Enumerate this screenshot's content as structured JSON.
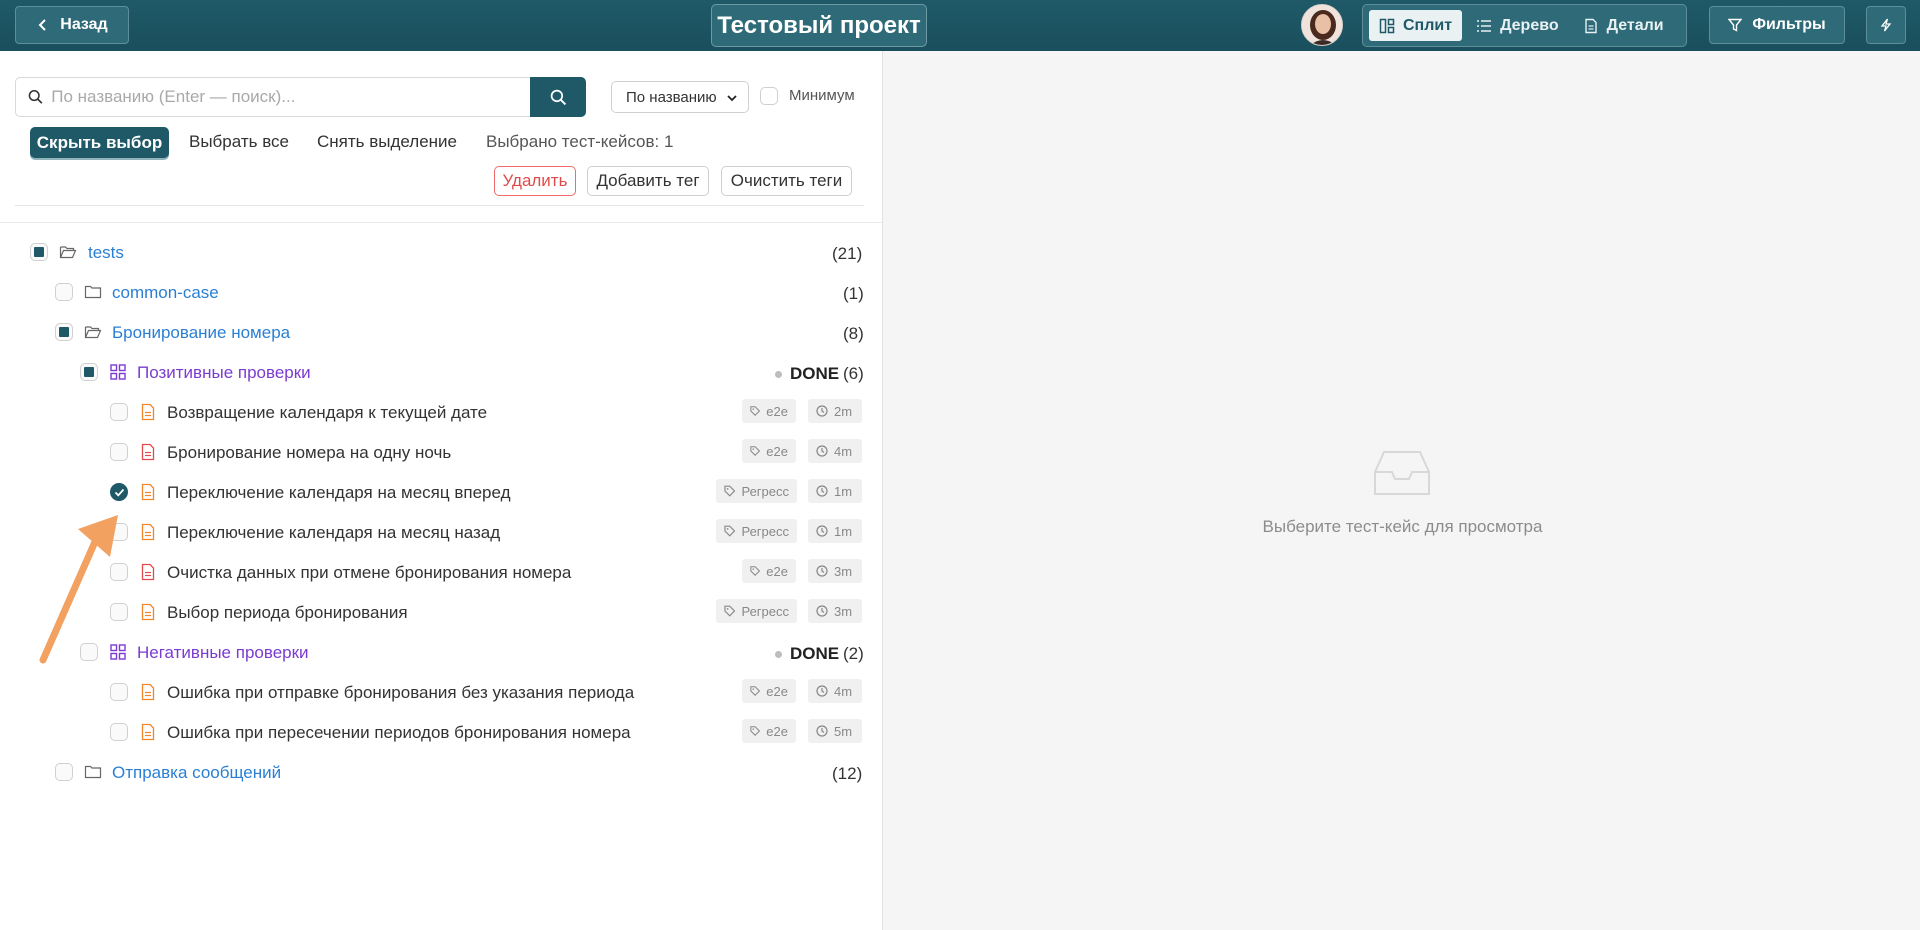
{
  "header": {
    "back_label": "Назад",
    "project_title": "Тестовый проект",
    "views": [
      {
        "label": "Сплит",
        "icon": "split-icon",
        "active": true
      },
      {
        "label": "Дерево",
        "icon": "list-icon",
        "active": false
      },
      {
        "label": "Детали",
        "icon": "document-icon",
        "active": false
      }
    ],
    "filters_label": "Фильтры",
    "accent": "#1f5967"
  },
  "toolbar": {
    "search_placeholder": "По названию (Enter — поиск)...",
    "sort_value": "По названию",
    "minimum_label": "Минимум",
    "hide_selection_label": "Скрыть выбор",
    "select_all_label": "Выбрать все",
    "deselect_label": "Снять выделение",
    "selected_count_label": "Выбрано тест-кейсов: 1",
    "delete_label": "Удалить",
    "add_tag_label": "Добавить тег",
    "clear_tags_label": "Очистить теги"
  },
  "tree": {
    "root": {
      "name": "tests",
      "count": "(21)"
    },
    "common": {
      "name": "common-case",
      "count": "(1)"
    },
    "booking": {
      "name": "Бронирование номера",
      "count": "(8)"
    },
    "positive": {
      "name": "Позитивные проверки",
      "status": "DONE",
      "count": "(6)"
    },
    "positive_cases": [
      {
        "name": "Возвращение календаря к текущей дате",
        "tag": "e2e",
        "time": "2m"
      },
      {
        "name": "Бронирование номера на одну ночь",
        "tag": "e2e",
        "time": "4m"
      },
      {
        "name": "Переключение календаря на месяц вперед",
        "tag": "Регресс",
        "time": "1m"
      },
      {
        "name": "Переключение календаря на месяц назад",
        "tag": "Регресс",
        "time": "1m"
      },
      {
        "name": "Очистка данных при отмене бронирования номера",
        "tag": "e2e",
        "time": "3m"
      },
      {
        "name": "Выбор периода бронирования",
        "tag": "Регресс",
        "time": "3m"
      }
    ],
    "negative": {
      "name": "Негативные проверки",
      "status": "DONE",
      "count": "(2)"
    },
    "negative_cases": [
      {
        "name": "Ошибка при отправке бронирования без указания периода",
        "tag": "e2e",
        "time": "4m"
      },
      {
        "name": "Ошибка при пересечении периодов бронирования номера",
        "tag": "e2e",
        "time": "5m"
      }
    ],
    "messages": {
      "name": "Отправка сообщений",
      "count": "(12)"
    }
  },
  "preview": {
    "empty_text": "Выберите тест-кейс для просмотра"
  }
}
